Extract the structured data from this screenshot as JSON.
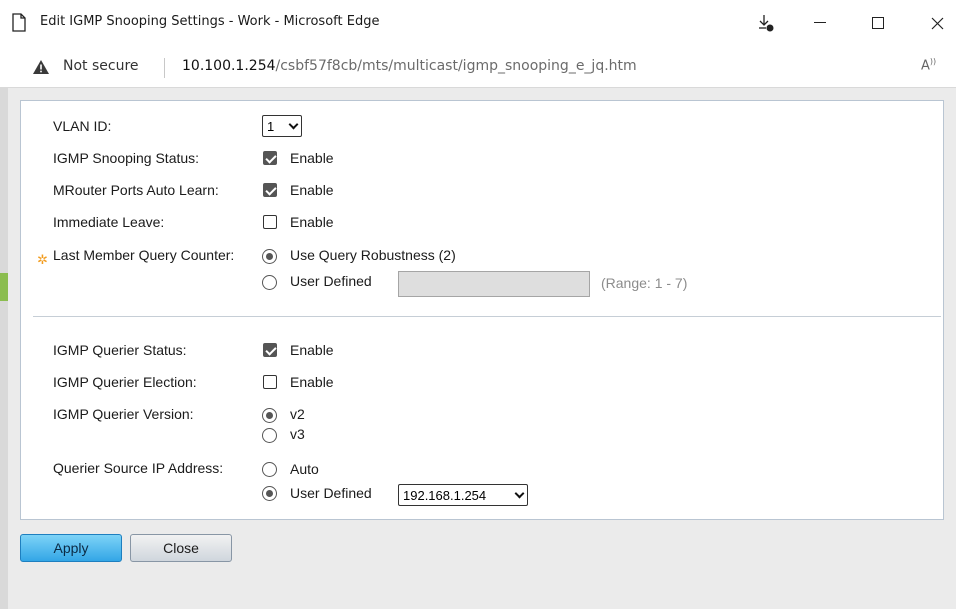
{
  "window": {
    "title": "Edit IGMP Snooping Settings - Work - Microsoft Edge"
  },
  "address_bar": {
    "security_label": "Not secure",
    "url_host": "10.100.1.254",
    "url_path": "/csbf57f8cb/mts/multicast/igmp_snooping_e_jq.htm",
    "read_aloud": "A"
  },
  "form": {
    "vlan_id": {
      "label": "VLAN ID:",
      "value": "1"
    },
    "igmp_snooping_status": {
      "label": "IGMP Snooping Status:",
      "option": "Enable",
      "checked": true
    },
    "mrouter_auto_learn": {
      "label": "MRouter Ports Auto Learn:",
      "option": "Enable",
      "checked": true
    },
    "immediate_leave": {
      "label": "Immediate Leave:",
      "option": "Enable",
      "checked": false
    },
    "last_member_query_counter": {
      "label": "Last Member Query Counter:",
      "options": [
        "Use Query Robustness (2)",
        "User Defined"
      ],
      "selected": "Use Query Robustness (2)",
      "range_hint": "(Range: 1 - 7)",
      "user_value": ""
    },
    "igmp_querier_status": {
      "label": "IGMP Querier Status:",
      "option": "Enable",
      "checked": true
    },
    "igmp_querier_election": {
      "label": "IGMP Querier Election:",
      "option": "Enable",
      "checked": false
    },
    "igmp_querier_version": {
      "label": "IGMP Querier Version:",
      "options": [
        "v2",
        "v3"
      ],
      "selected": "v2"
    },
    "querier_source_ip": {
      "label": "Querier Source IP Address:",
      "options": [
        "Auto",
        "User Defined"
      ],
      "selected": "User Defined",
      "ip_value": "192.168.1.254"
    }
  },
  "buttons": {
    "apply": "Apply",
    "close": "Close"
  },
  "colors": {
    "apply_bg": "#33a6e6",
    "required_marker": "#f29c1f",
    "disabled_input": "#dedede"
  }
}
